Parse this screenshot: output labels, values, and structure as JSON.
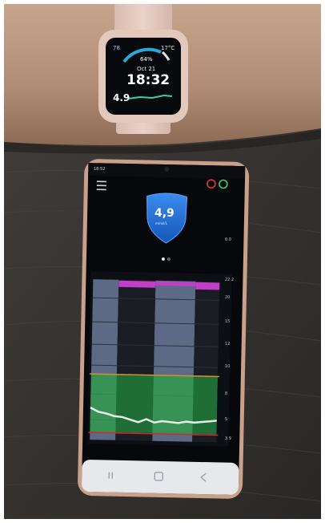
{
  "watch": {
    "battery": "78",
    "temperature": "17°C",
    "percent": "64%",
    "date": "Oct 21",
    "time": "18:32",
    "glucose": "4.9"
  },
  "phone": {
    "status_time": "18:52",
    "glucose_value": "4,9",
    "glucose_unit": "mmol/L",
    "side_value": "0.0",
    "axis_labels": [
      "22.2",
      "20",
      "15",
      "12",
      "10",
      "8",
      "5",
      "3.9"
    ]
  },
  "colors": {
    "wood": "#3a3835",
    "skin": "#b08c74",
    "watch_band": "#e4c8bc",
    "shield_blue": "#1d6fd8",
    "target_band": "#2f9a4c",
    "glucose_line": "#e8ece8",
    "low_line": "#d22a2a",
    "high_line": "#d8902a",
    "magenta_marks": "#c23ec8"
  }
}
